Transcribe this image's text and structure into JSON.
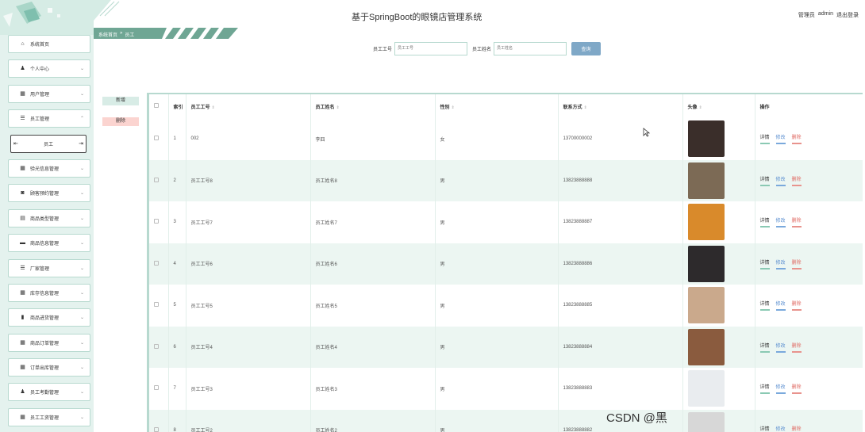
{
  "header": {
    "title": "基于SpringBoot的眼镜店管理系统",
    "user_role": "管理员",
    "user_name": "admin",
    "logout": "退出登录"
  },
  "breadcrumb": {
    "home": "系统首页",
    "sep": "»",
    "current": "员工"
  },
  "search": {
    "field1_label": "员工工号",
    "field1_placeholder": "员工工号",
    "field2_label": "员工姓名",
    "field2_placeholder": "员工姓名",
    "button": "查询"
  },
  "actions": {
    "add": "新增",
    "delete": "删除"
  },
  "sidebar": {
    "items": [
      {
        "label": "系统首页",
        "icon": "⌂"
      },
      {
        "label": "个人中心",
        "icon": "♟"
      },
      {
        "label": "用户管理",
        "icon": "▦"
      },
      {
        "label": "员工管理",
        "icon": "☰"
      },
      {
        "label": "员工",
        "icon": ""
      },
      {
        "label": "验光信息管理",
        "icon": "▦"
      },
      {
        "label": "顾客预约管理",
        "icon": "◙"
      },
      {
        "label": "商品类型管理",
        "icon": "▤"
      },
      {
        "label": "商品信息管理",
        "icon": "▬"
      },
      {
        "label": "厂家管理",
        "icon": "☰"
      },
      {
        "label": "库存信息管理",
        "icon": "▦"
      },
      {
        "label": "商品进货管理",
        "icon": "▮"
      },
      {
        "label": "商品订单管理",
        "icon": "▦"
      },
      {
        "label": "订单出库管理",
        "icon": "▦"
      },
      {
        "label": "员工考勤管理",
        "icon": "♟"
      },
      {
        "label": "员工工资管理",
        "icon": "▦"
      }
    ]
  },
  "table": {
    "columns": [
      "索引",
      "员工工号",
      "员工姓名",
      "性别",
      "联系方式",
      "头像",
      "操作"
    ],
    "ops": {
      "detail": "详情",
      "edit": "修改",
      "delete": "删除"
    },
    "rows": [
      {
        "index": "1",
        "id": "002",
        "name": "李四",
        "gender": "女",
        "phone": "13700000002",
        "avatar_color": "#3a2e2a"
      },
      {
        "index": "2",
        "id": "员工工号8",
        "name": "员工姓名8",
        "gender": "男",
        "phone": "13823888888",
        "avatar_color": "#7c6a55"
      },
      {
        "index": "3",
        "id": "员工工号7",
        "name": "员工姓名7",
        "gender": "男",
        "phone": "13823888887",
        "avatar_color": "#d98a2b"
      },
      {
        "index": "4",
        "id": "员工工号6",
        "name": "员工姓名6",
        "gender": "男",
        "phone": "13823888886",
        "avatar_color": "#2d2a2c"
      },
      {
        "index": "5",
        "id": "员工工号5",
        "name": "员工姓名5",
        "gender": "男",
        "phone": "13823888885",
        "avatar_color": "#caa98c"
      },
      {
        "index": "6",
        "id": "员工工号4",
        "name": "员工姓名4",
        "gender": "男",
        "phone": "13823888884",
        "avatar_color": "#8a5b3e"
      },
      {
        "index": "7",
        "id": "员工工号3",
        "name": "员工姓名3",
        "gender": "男",
        "phone": "13823888883",
        "avatar_color": "#e9ecef"
      },
      {
        "index": "8",
        "id": "员工工号2",
        "name": "员工姓名2",
        "gender": "男",
        "phone": "13823888882",
        "avatar_color": "#d7d7d7"
      }
    ]
  },
  "watermark": "CSDN @黑"
}
